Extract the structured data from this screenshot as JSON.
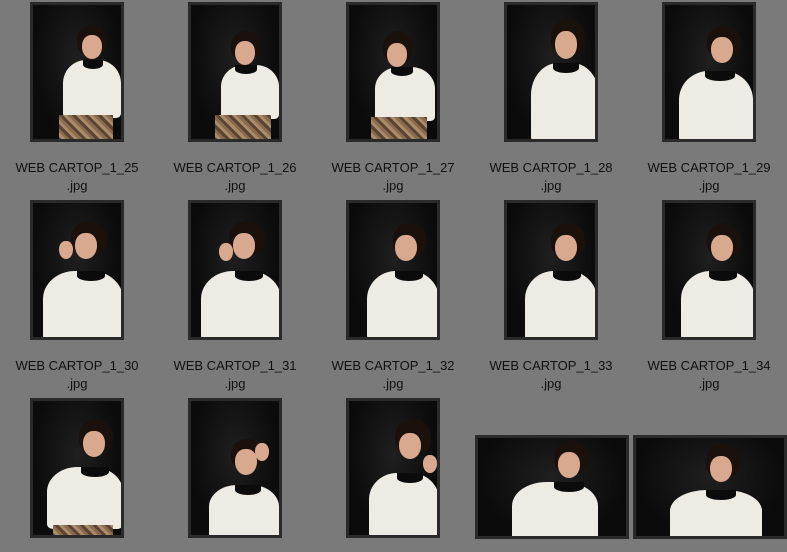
{
  "thumbnails": [
    {
      "name": "WEB CARTOP_1_25",
      "ext": ".jpg"
    },
    {
      "name": "WEB CARTOP_1_26",
      "ext": ".jpg"
    },
    {
      "name": "WEB CARTOP_1_27",
      "ext": ".jpg"
    },
    {
      "name": "WEB CARTOP_1_28",
      "ext": ".jpg"
    },
    {
      "name": "WEB CARTOP_1_29",
      "ext": ".jpg"
    },
    {
      "name": "WEB CARTOP_1_30",
      "ext": ".jpg"
    },
    {
      "name": "WEB CARTOP_1_31",
      "ext": ".jpg"
    },
    {
      "name": "WEB CARTOP_1_32",
      "ext": ".jpg"
    },
    {
      "name": "WEB CARTOP_1_33",
      "ext": ".jpg"
    },
    {
      "name": "WEB CARTOP_1_34",
      "ext": ".jpg"
    }
  ]
}
